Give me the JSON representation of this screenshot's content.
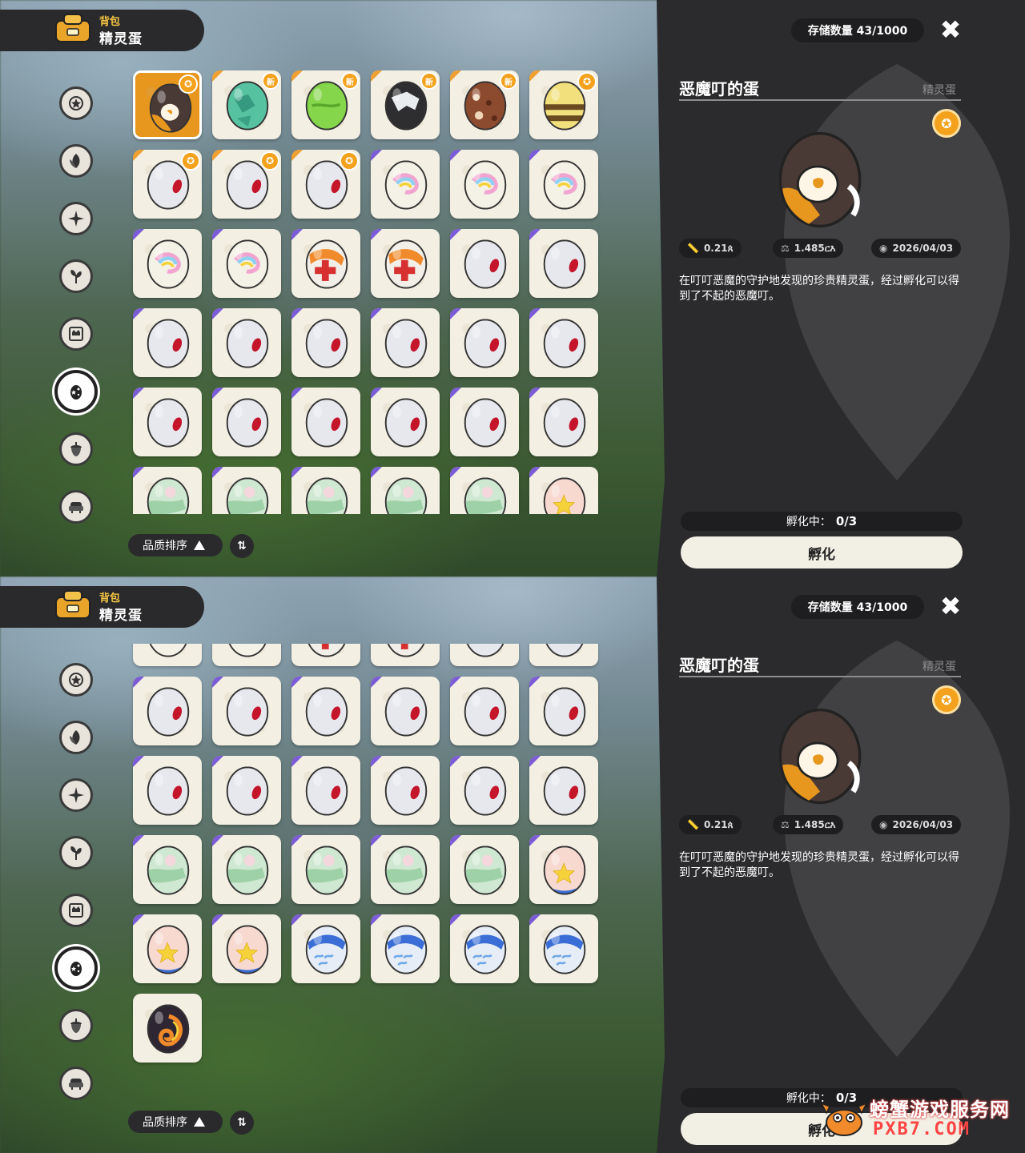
{
  "header": {
    "small": "背包",
    "big": "精灵蛋"
  },
  "storage": "存储数量 43/1000",
  "close_glyph": "✖",
  "sort": {
    "label": "品质排序",
    "toggle_glyph": "⇅"
  },
  "detail": {
    "title": "恶魔叮的蛋",
    "category": "精灵蛋",
    "stats": [
      {
        "icon": "ruler-icon",
        "glyph": "📏",
        "value": "0.21ጰ"
      },
      {
        "icon": "weight-icon",
        "glyph": "⚖",
        "value": "1.485ርእ"
      },
      {
        "icon": "eye-icon",
        "glyph": "◉",
        "value": "2026/04/03"
      }
    ],
    "description": "在叮叮恶魔的守护地发现的珍贵精灵蛋，经过孵化可以得到了不起的恶魔叮。",
    "hatch_label": "孵化中：",
    "hatch_count": "0/3",
    "hatch_button": "孵化"
  },
  "badges": {
    "new": "新",
    "medal": "✪"
  },
  "sidebar_icons": [
    "star-badge-icon",
    "leaf-icon",
    "sparkle-icon",
    "plant-icon",
    "crown-card-icon",
    "egg-category-icon",
    "acorn-icon",
    "armchair-icon"
  ],
  "watermark": {
    "cn": "螃蟹游戏服务网",
    "en": "PXB7.COM"
  },
  "eggs_panel1": [
    [
      {
        "t": "penguin",
        "b": "medal",
        "c": "none",
        "sel": true
      },
      {
        "t": "green",
        "b": "new",
        "c": "orange"
      },
      {
        "t": "lime",
        "b": "new",
        "c": "orange"
      },
      {
        "t": "black",
        "b": "new",
        "c": "orange"
      },
      {
        "t": "brown",
        "b": "new",
        "c": "orange"
      },
      {
        "t": "bee",
        "b": "medal",
        "c": "orange"
      }
    ],
    [
      {
        "t": "white",
        "b": "medal",
        "c": "orange"
      },
      {
        "t": "white",
        "b": "medal",
        "c": "orange"
      },
      {
        "t": "white",
        "b": "medal",
        "c": "orange"
      },
      {
        "t": "rainbow",
        "b": "",
        "c": "purple"
      },
      {
        "t": "rainbow",
        "b": "",
        "c": "purple"
      },
      {
        "t": "rainbow",
        "b": "",
        "c": "purple"
      }
    ],
    [
      {
        "t": "rainbow",
        "b": "",
        "c": "purple"
      },
      {
        "t": "rainbow",
        "b": "",
        "c": "purple"
      },
      {
        "t": "cross",
        "b": "",
        "c": "purple"
      },
      {
        "t": "cross",
        "b": "",
        "c": "purple"
      },
      {
        "t": "white",
        "b": "",
        "c": "purple"
      },
      {
        "t": "white",
        "b": "",
        "c": "purple"
      }
    ],
    [
      {
        "t": "white",
        "b": "",
        "c": "purple"
      },
      {
        "t": "white",
        "b": "",
        "c": "purple"
      },
      {
        "t": "white",
        "b": "",
        "c": "purple"
      },
      {
        "t": "white",
        "b": "",
        "c": "purple"
      },
      {
        "t": "white",
        "b": "",
        "c": "purple"
      },
      {
        "t": "white",
        "b": "",
        "c": "purple"
      }
    ],
    [
      {
        "t": "white",
        "b": "",
        "c": "purple"
      },
      {
        "t": "white",
        "b": "",
        "c": "purple"
      },
      {
        "t": "white",
        "b": "",
        "c": "purple"
      },
      {
        "t": "white",
        "b": "",
        "c": "purple"
      },
      {
        "t": "white",
        "b": "",
        "c": "purple"
      },
      {
        "t": "white",
        "b": "",
        "c": "purple"
      }
    ],
    [
      {
        "t": "mint",
        "b": "",
        "c": "purple"
      },
      {
        "t": "mint",
        "b": "",
        "c": "purple"
      },
      {
        "t": "mint",
        "b": "",
        "c": "purple"
      },
      {
        "t": "mint",
        "b": "",
        "c": "purple"
      },
      {
        "t": "mint",
        "b": "",
        "c": "purple"
      },
      {
        "t": "star",
        "b": "",
        "c": "purple"
      }
    ]
  ],
  "eggs_panel2": [
    [
      {
        "t": "rainbow",
        "b": "",
        "c": "purple"
      },
      {
        "t": "rainbow",
        "b": "",
        "c": "purple"
      },
      {
        "t": "cross",
        "b": "",
        "c": "purple"
      },
      {
        "t": "cross",
        "b": "",
        "c": "purple"
      },
      {
        "t": "white",
        "b": "",
        "c": "purple"
      },
      {
        "t": "white",
        "b": "",
        "c": "purple"
      }
    ],
    [
      {
        "t": "white",
        "b": "",
        "c": "purple"
      },
      {
        "t": "white",
        "b": "",
        "c": "purple"
      },
      {
        "t": "white",
        "b": "",
        "c": "purple"
      },
      {
        "t": "white",
        "b": "",
        "c": "purple"
      },
      {
        "t": "white",
        "b": "",
        "c": "purple"
      },
      {
        "t": "white",
        "b": "",
        "c": "purple"
      }
    ],
    [
      {
        "t": "white",
        "b": "",
        "c": "purple"
      },
      {
        "t": "white",
        "b": "",
        "c": "purple"
      },
      {
        "t": "white",
        "b": "",
        "c": "purple"
      },
      {
        "t": "white",
        "b": "",
        "c": "purple"
      },
      {
        "t": "white",
        "b": "",
        "c": "purple"
      },
      {
        "t": "white",
        "b": "",
        "c": "purple"
      }
    ],
    [
      {
        "t": "mint",
        "b": "",
        "c": "purple"
      },
      {
        "t": "mint",
        "b": "",
        "c": "purple"
      },
      {
        "t": "mint",
        "b": "",
        "c": "purple"
      },
      {
        "t": "mint",
        "b": "",
        "c": "purple"
      },
      {
        "t": "mint",
        "b": "",
        "c": "purple"
      },
      {
        "t": "star",
        "b": "",
        "c": "purple"
      }
    ],
    [
      {
        "t": "star",
        "b": "",
        "c": "purple"
      },
      {
        "t": "star",
        "b": "",
        "c": "purple"
      },
      {
        "t": "wave",
        "b": "",
        "c": "purple"
      },
      {
        "t": "wave",
        "b": "",
        "c": "purple"
      },
      {
        "t": "wave",
        "b": "",
        "c": "purple"
      },
      {
        "t": "wave",
        "b": "",
        "c": "purple"
      }
    ],
    [
      {
        "t": "flame",
        "b": "",
        "c": "none"
      }
    ]
  ]
}
